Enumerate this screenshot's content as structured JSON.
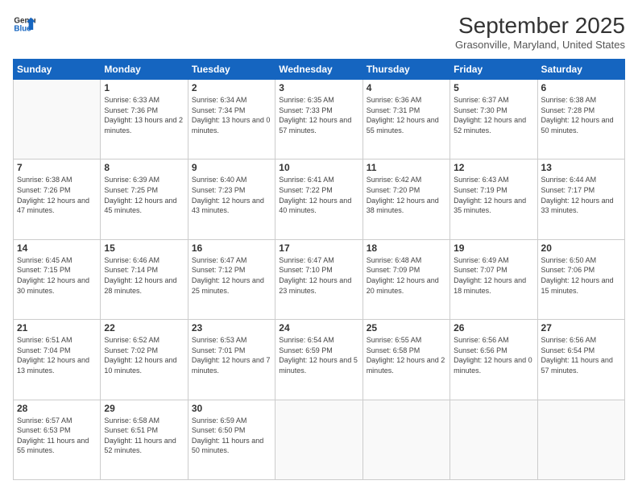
{
  "logo": {
    "line1": "General",
    "line2": "Blue"
  },
  "title": "September 2025",
  "location": "Grasonville, Maryland, United States",
  "weekdays": [
    "Sunday",
    "Monday",
    "Tuesday",
    "Wednesday",
    "Thursday",
    "Friday",
    "Saturday"
  ],
  "weeks": [
    [
      {
        "day": "",
        "sunrise": "",
        "sunset": "",
        "daylight": ""
      },
      {
        "day": "1",
        "sunrise": "Sunrise: 6:33 AM",
        "sunset": "Sunset: 7:36 PM",
        "daylight": "Daylight: 13 hours and 2 minutes."
      },
      {
        "day": "2",
        "sunrise": "Sunrise: 6:34 AM",
        "sunset": "Sunset: 7:34 PM",
        "daylight": "Daylight: 13 hours and 0 minutes."
      },
      {
        "day": "3",
        "sunrise": "Sunrise: 6:35 AM",
        "sunset": "Sunset: 7:33 PM",
        "daylight": "Daylight: 12 hours and 57 minutes."
      },
      {
        "day": "4",
        "sunrise": "Sunrise: 6:36 AM",
        "sunset": "Sunset: 7:31 PM",
        "daylight": "Daylight: 12 hours and 55 minutes."
      },
      {
        "day": "5",
        "sunrise": "Sunrise: 6:37 AM",
        "sunset": "Sunset: 7:30 PM",
        "daylight": "Daylight: 12 hours and 52 minutes."
      },
      {
        "day": "6",
        "sunrise": "Sunrise: 6:38 AM",
        "sunset": "Sunset: 7:28 PM",
        "daylight": "Daylight: 12 hours and 50 minutes."
      }
    ],
    [
      {
        "day": "7",
        "sunrise": "Sunrise: 6:38 AM",
        "sunset": "Sunset: 7:26 PM",
        "daylight": "Daylight: 12 hours and 47 minutes."
      },
      {
        "day": "8",
        "sunrise": "Sunrise: 6:39 AM",
        "sunset": "Sunset: 7:25 PM",
        "daylight": "Daylight: 12 hours and 45 minutes."
      },
      {
        "day": "9",
        "sunrise": "Sunrise: 6:40 AM",
        "sunset": "Sunset: 7:23 PM",
        "daylight": "Daylight: 12 hours and 43 minutes."
      },
      {
        "day": "10",
        "sunrise": "Sunrise: 6:41 AM",
        "sunset": "Sunset: 7:22 PM",
        "daylight": "Daylight: 12 hours and 40 minutes."
      },
      {
        "day": "11",
        "sunrise": "Sunrise: 6:42 AM",
        "sunset": "Sunset: 7:20 PM",
        "daylight": "Daylight: 12 hours and 38 minutes."
      },
      {
        "day": "12",
        "sunrise": "Sunrise: 6:43 AM",
        "sunset": "Sunset: 7:19 PM",
        "daylight": "Daylight: 12 hours and 35 minutes."
      },
      {
        "day": "13",
        "sunrise": "Sunrise: 6:44 AM",
        "sunset": "Sunset: 7:17 PM",
        "daylight": "Daylight: 12 hours and 33 minutes."
      }
    ],
    [
      {
        "day": "14",
        "sunrise": "Sunrise: 6:45 AM",
        "sunset": "Sunset: 7:15 PM",
        "daylight": "Daylight: 12 hours and 30 minutes."
      },
      {
        "day": "15",
        "sunrise": "Sunrise: 6:46 AM",
        "sunset": "Sunset: 7:14 PM",
        "daylight": "Daylight: 12 hours and 28 minutes."
      },
      {
        "day": "16",
        "sunrise": "Sunrise: 6:47 AM",
        "sunset": "Sunset: 7:12 PM",
        "daylight": "Daylight: 12 hours and 25 minutes."
      },
      {
        "day": "17",
        "sunrise": "Sunrise: 6:47 AM",
        "sunset": "Sunset: 7:10 PM",
        "daylight": "Daylight: 12 hours and 23 minutes."
      },
      {
        "day": "18",
        "sunrise": "Sunrise: 6:48 AM",
        "sunset": "Sunset: 7:09 PM",
        "daylight": "Daylight: 12 hours and 20 minutes."
      },
      {
        "day": "19",
        "sunrise": "Sunrise: 6:49 AM",
        "sunset": "Sunset: 7:07 PM",
        "daylight": "Daylight: 12 hours and 18 minutes."
      },
      {
        "day": "20",
        "sunrise": "Sunrise: 6:50 AM",
        "sunset": "Sunset: 7:06 PM",
        "daylight": "Daylight: 12 hours and 15 minutes."
      }
    ],
    [
      {
        "day": "21",
        "sunrise": "Sunrise: 6:51 AM",
        "sunset": "Sunset: 7:04 PM",
        "daylight": "Daylight: 12 hours and 13 minutes."
      },
      {
        "day": "22",
        "sunrise": "Sunrise: 6:52 AM",
        "sunset": "Sunset: 7:02 PM",
        "daylight": "Daylight: 12 hours and 10 minutes."
      },
      {
        "day": "23",
        "sunrise": "Sunrise: 6:53 AM",
        "sunset": "Sunset: 7:01 PM",
        "daylight": "Daylight: 12 hours and 7 minutes."
      },
      {
        "day": "24",
        "sunrise": "Sunrise: 6:54 AM",
        "sunset": "Sunset: 6:59 PM",
        "daylight": "Daylight: 12 hours and 5 minutes."
      },
      {
        "day": "25",
        "sunrise": "Sunrise: 6:55 AM",
        "sunset": "Sunset: 6:58 PM",
        "daylight": "Daylight: 12 hours and 2 minutes."
      },
      {
        "day": "26",
        "sunrise": "Sunrise: 6:56 AM",
        "sunset": "Sunset: 6:56 PM",
        "daylight": "Daylight: 12 hours and 0 minutes."
      },
      {
        "day": "27",
        "sunrise": "Sunrise: 6:56 AM",
        "sunset": "Sunset: 6:54 PM",
        "daylight": "Daylight: 11 hours and 57 minutes."
      }
    ],
    [
      {
        "day": "28",
        "sunrise": "Sunrise: 6:57 AM",
        "sunset": "Sunset: 6:53 PM",
        "daylight": "Daylight: 11 hours and 55 minutes."
      },
      {
        "day": "29",
        "sunrise": "Sunrise: 6:58 AM",
        "sunset": "Sunset: 6:51 PM",
        "daylight": "Daylight: 11 hours and 52 minutes."
      },
      {
        "day": "30",
        "sunrise": "Sunrise: 6:59 AM",
        "sunset": "Sunset: 6:50 PM",
        "daylight": "Daylight: 11 hours and 50 minutes."
      },
      {
        "day": "",
        "sunrise": "",
        "sunset": "",
        "daylight": ""
      },
      {
        "day": "",
        "sunrise": "",
        "sunset": "",
        "daylight": ""
      },
      {
        "day": "",
        "sunrise": "",
        "sunset": "",
        "daylight": ""
      },
      {
        "day": "",
        "sunrise": "",
        "sunset": "",
        "daylight": ""
      }
    ]
  ]
}
